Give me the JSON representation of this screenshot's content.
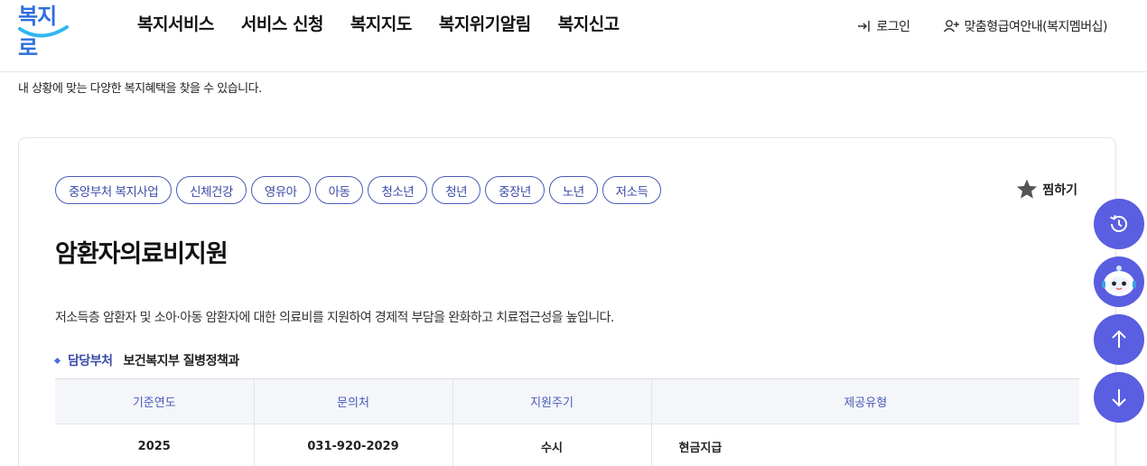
{
  "header": {
    "logo_text": "복지로",
    "nav": [
      "복지서비스",
      "서비스 신청",
      "복지지도",
      "복지위기알림",
      "복지신고"
    ],
    "login": "로그인",
    "membership": "맞춤형급여안내(복지멤버십)"
  },
  "intro": "내 상황에 맞는 다양한 복지혜택을 찾을 수 있습니다.",
  "service": {
    "tags": [
      "중앙부처 복지사업",
      "신체건강",
      "영유아",
      "아동",
      "청소년",
      "청년",
      "중장년",
      "노년",
      "저소득"
    ],
    "bookmark": "찜하기",
    "title": "암환자의료비지원",
    "description": "저소득층 암환자 및 소아·아동 암환자에 대한 의료비를 지원하여 경제적 부담을 완화하고 치료접근성을 높입니다.",
    "dept_label": "담당부처",
    "dept_value": "보건복지부 질병정책과",
    "table": {
      "headers": [
        "기준연도",
        "문의처",
        "지원주기",
        "제공유형"
      ],
      "row": [
        "2025",
        "031-920-2029",
        "수시",
        "현금지급"
      ]
    }
  },
  "colors": {
    "accent": "#4a5ab8",
    "float_button": "#5a5ee0",
    "logo": "#2f6fdc"
  },
  "icons": {
    "login": "login-icon",
    "member": "user-plus-icon",
    "bookmark": "star-icon",
    "history": "history-icon",
    "chatbot": "chatbot-icon",
    "top": "arrow-up-icon",
    "bottom": "arrow-down-icon"
  }
}
